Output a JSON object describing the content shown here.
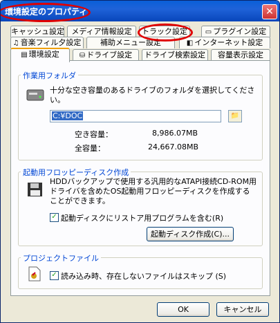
{
  "window": {
    "title": "環境設定のプロパティ",
    "close_glyph": "✕"
  },
  "tabs": {
    "row1": [
      {
        "label": "キャッシュ設定"
      },
      {
        "label": "メディア情報設定"
      },
      {
        "label": "トラック設定"
      },
      {
        "label": "プラグイン設定",
        "icon": "plugin-icon"
      }
    ],
    "row2": [
      {
        "label": "音楽フィル夕設定",
        "icon": "music-filter-icon"
      },
      {
        "label": "補助メニュー設定"
      },
      {
        "label": "インターネット設定",
        "icon": "internet-icon"
      }
    ],
    "row3": [
      {
        "label": "環境設定",
        "icon": "environment-icon",
        "active": true
      },
      {
        "label": "ドライブ設定",
        "icon": "drive-icon"
      },
      {
        "label": "ドライブ検索設定"
      },
      {
        "label": "容量表示設定"
      }
    ]
  },
  "work_folder": {
    "legend": "作業用フォルダ",
    "description": "十分な空き容量のあるドライブのフォルダを選択してください。",
    "path_value": "C:¥DOC",
    "free_label": "空き容量：",
    "free_value": "8,986.07MB",
    "total_label": "全容量：",
    "total_value": "24,667.08MB"
  },
  "boot_floppy": {
    "legend": "起動用フロッピーディスク作成",
    "description": "HDDバックアップで使用する汎用的なATAPI接続CD-ROM用ドライバを含めたOS起動用フロッピーディスクを作成することができます。",
    "checkbox_label": "起動ディスクにリストア用プログラムを含む(R)",
    "checkbox_checked": true,
    "create_button": "起動ディスク作成(C)..."
  },
  "project_file": {
    "legend": "プロジェクトファイル",
    "checkbox_label": "読み込み時、存在しないファイルはスキップ (S)",
    "checkbox_checked": true
  },
  "footer": {
    "ok": "OK",
    "cancel": "キャンセル"
  },
  "colors": {
    "title_bar": "#0a5fd8",
    "legend_text": "#0046d5",
    "annotation": "#e00000"
  }
}
